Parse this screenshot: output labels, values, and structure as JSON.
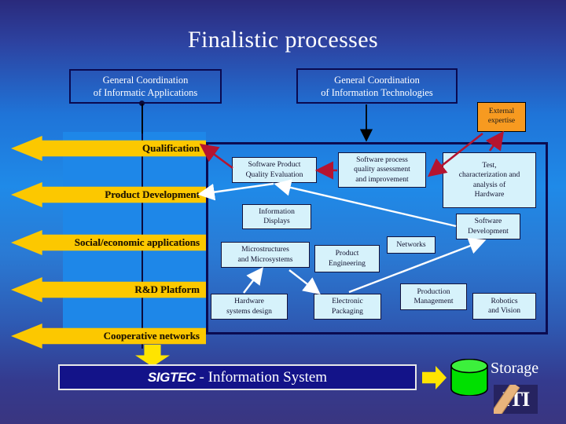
{
  "slide": {
    "title": "Finalistic processes"
  },
  "coordination": {
    "left": {
      "line1": "General Coordination",
      "line2": "of Informatic Applications"
    },
    "right": {
      "line1": "General Coordination",
      "line2": "of Information Technologies"
    }
  },
  "external": {
    "line1": "External",
    "line2": "expertise"
  },
  "lanes": [
    {
      "label": "Qualification"
    },
    {
      "label": "Product Development"
    },
    {
      "label": "Social/economic applications"
    },
    {
      "label": "R&D Platform"
    },
    {
      "label": "Cooperative networks"
    }
  ],
  "processes": {
    "software_product_quality_evaluation": {
      "line1": "Software Product",
      "line2": "Quality Evaluation"
    },
    "software_process_quality": {
      "line1": "Software process",
      "line2": "quality assessment",
      "line3": "and improvement"
    },
    "test_characterization": {
      "line1": "Test,",
      "line2": "characterization and",
      "line3": "analysis of",
      "line4": "Hardware"
    },
    "information_displays": {
      "line1": "Information",
      "line2": "Displays"
    },
    "software_development": {
      "line1": "Software",
      "line2": "Development"
    },
    "microstructures": {
      "line1": "Microstructures",
      "line2": "and Microsystems"
    },
    "product_engineering": {
      "line1": "Product",
      "line2": "Engineering"
    },
    "networks": {
      "line1": "Networks"
    },
    "hardware_systems_design": {
      "line1": "Hardware",
      "line2": "systems design"
    },
    "electronic_packaging": {
      "line1": "Electronic",
      "line2": "Packaging"
    },
    "production_management": {
      "line1": "Production",
      "line2": "Management"
    },
    "robotics_and_vision": {
      "line1": "Robotics",
      "line2": "and Vision"
    }
  },
  "footer": {
    "sigtec_word": "SIGTEC",
    "sigtec_rest": " - Information System",
    "storage_label": "Storage",
    "iti_label": "ITI"
  },
  "colors": {
    "background_top": "#2a2a7c",
    "background_mid": "#1f8ae8",
    "lane_yellow": "#fcc800",
    "process_box": "#d6f2fb",
    "external_orange": "#f79a20",
    "red_arrow": "#b51430",
    "white_arrow": "#ffffff",
    "sigtec_bar": "#131389",
    "cylinder_green": "#00e000"
  }
}
